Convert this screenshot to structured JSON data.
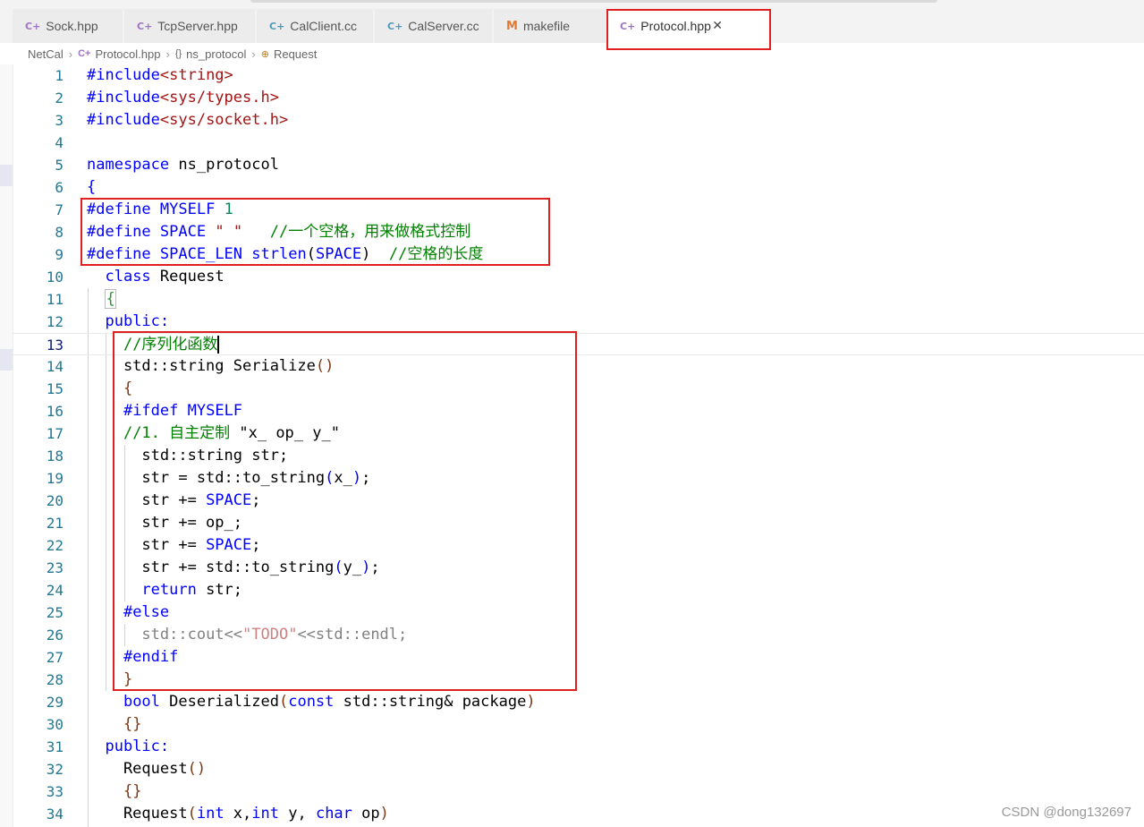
{
  "tabs": [
    {
      "label": "Sock.hpp",
      "icon": "cpp-file-icon",
      "kind": "cpp"
    },
    {
      "label": "TcpServer.hpp",
      "icon": "cpp-file-icon",
      "kind": "cpp"
    },
    {
      "label": "CalClient.cc",
      "icon": "cc-file-icon",
      "kind": "cc"
    },
    {
      "label": "CalServer.cc",
      "icon": "cc-file-icon",
      "kind": "cc"
    },
    {
      "label": "makefile",
      "icon": "makefile-icon",
      "kind": "mk"
    },
    {
      "label": "Protocol.hpp",
      "icon": "cpp-file-icon",
      "kind": "cpp",
      "active": true
    }
  ],
  "breadcrumb": {
    "folder": "NetCal",
    "file": "Protocol.hpp",
    "namespace": "ns_protocol",
    "symbol": "Request"
  },
  "editor": {
    "current_line": 13,
    "lines": [
      {
        "n": 1,
        "text": "#include<string>"
      },
      {
        "n": 2,
        "text": "#include<sys/types.h>"
      },
      {
        "n": 3,
        "text": "#include<sys/socket.h>"
      },
      {
        "n": 4,
        "text": ""
      },
      {
        "n": 5,
        "text": "namespace ns_protocol"
      },
      {
        "n": 6,
        "text": "{"
      },
      {
        "n": 7,
        "text": "#define MYSELF 1"
      },
      {
        "n": 8,
        "text": "#define SPACE \" \"   //一个空格，用来做格式控制"
      },
      {
        "n": 9,
        "text": "#define SPACE_LEN strlen(SPACE)  //空格的长度"
      },
      {
        "n": 10,
        "text": "  class Request"
      },
      {
        "n": 11,
        "text": "  {"
      },
      {
        "n": 12,
        "text": "  public:"
      },
      {
        "n": 13,
        "text": "    //序列化函数"
      },
      {
        "n": 14,
        "text": "    std::string Serialize()"
      },
      {
        "n": 15,
        "text": "    {"
      },
      {
        "n": 16,
        "text": "    #ifdef MYSELF"
      },
      {
        "n": 17,
        "text": "    //1. 自主定制 \"x_ op_ y_\""
      },
      {
        "n": 18,
        "text": "      std::string str;"
      },
      {
        "n": 19,
        "text": "      str = std::to_string(x_);"
      },
      {
        "n": 20,
        "text": "      str += SPACE;"
      },
      {
        "n": 21,
        "text": "      str += op_;"
      },
      {
        "n": 22,
        "text": "      str += SPACE;"
      },
      {
        "n": 23,
        "text": "      str += std::to_string(y_);"
      },
      {
        "n": 24,
        "text": "      return str;"
      },
      {
        "n": 25,
        "text": "    #else"
      },
      {
        "n": 26,
        "text": "      std::cout<<\"TODO\"<<std::endl;"
      },
      {
        "n": 27,
        "text": "    #endif"
      },
      {
        "n": 28,
        "text": "    }"
      },
      {
        "n": 29,
        "text": "    bool Deserialized(const std::string& package)"
      },
      {
        "n": 30,
        "text": "    {}"
      },
      {
        "n": 31,
        "text": "  public:"
      },
      {
        "n": 32,
        "text": "    Request()"
      },
      {
        "n": 33,
        "text": "    {}"
      },
      {
        "n": 34,
        "text": "    Request(int x,int y, char op)"
      }
    ]
  },
  "watermark": "CSDN @dong132697",
  "colors": {
    "keyword": "#0000ff",
    "string": "#a31515",
    "comment": "#008000",
    "number": "#098658",
    "line_number": "#237893",
    "highlight_box": "#e02020"
  }
}
